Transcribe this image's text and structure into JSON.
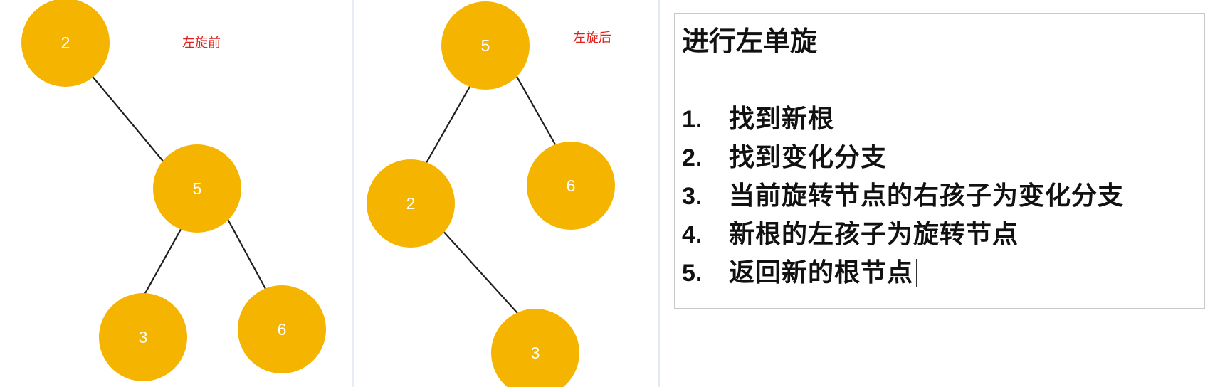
{
  "before": {
    "caption": "左旋前",
    "nodes": [
      {
        "id": "n2",
        "label": "2"
      },
      {
        "id": "n5",
        "label": "5"
      },
      {
        "id": "n3",
        "label": "3"
      },
      {
        "id": "n6",
        "label": "6"
      }
    ],
    "edges": [
      {
        "from": "n2",
        "to": "n5"
      },
      {
        "from": "n5",
        "to": "n3"
      },
      {
        "from": "n5",
        "to": "n6"
      }
    ]
  },
  "after": {
    "caption": "左旋后",
    "nodes": [
      {
        "id": "n5",
        "label": "5"
      },
      {
        "id": "n2",
        "label": "2"
      },
      {
        "id": "n6",
        "label": "6"
      },
      {
        "id": "n3",
        "label": "3"
      }
    ],
    "edges": [
      {
        "from": "n5",
        "to": "n2"
      },
      {
        "from": "n5",
        "to": "n6"
      },
      {
        "from": "n2",
        "to": "n3"
      }
    ]
  },
  "steps": {
    "title": "进行左单旋",
    "items": [
      {
        "num": "1.",
        "text": "找到新根"
      },
      {
        "num": "2.",
        "text": "找到变化分支"
      },
      {
        "num": "3.",
        "text": "当前旋转节点的右孩子为变化分支"
      },
      {
        "num": "4.",
        "text": "新根的左孩子为旋转节点"
      },
      {
        "num": "5.",
        "text": "返回新的根节点"
      }
    ]
  },
  "colors": {
    "node_fill": "#f5b400",
    "node_text": "#ffffff",
    "caption": "#e0201c",
    "edge": "#1f1f1f"
  }
}
